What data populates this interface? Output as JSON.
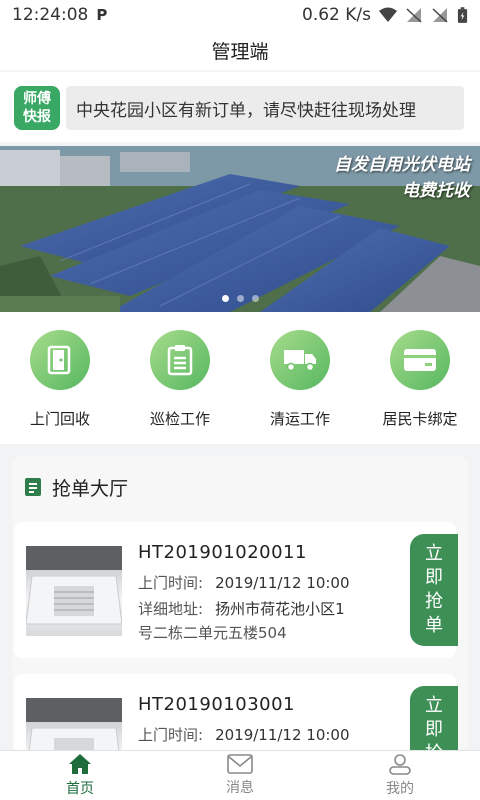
{
  "status": {
    "time": "12:24:08",
    "notification_app": "P",
    "speed": "0.62 K/s"
  },
  "header": {
    "title": "管理端"
  },
  "notice": {
    "badge_line1": "师傅",
    "badge_line2": "快报",
    "text": "中央花园小区有新订单，请尽快赶往现场处理"
  },
  "banner": {
    "caption_line1": "自发自用光伏电站",
    "caption_line2": "电费托收",
    "slides": 3,
    "active_slide": 0
  },
  "menu": [
    {
      "label": "上门回收",
      "icon": "door-icon"
    },
    {
      "label": "巡检工作",
      "icon": "clipboard-icon"
    },
    {
      "label": "清运工作",
      "icon": "truck-icon"
    },
    {
      "label": "居民卡绑定",
      "icon": "card-icon"
    }
  ],
  "hall": {
    "title": "抢单大厅",
    "orders": [
      {
        "id": "HT201901020011",
        "time_label": "上门时间:",
        "time": "2019/11/12 10:00",
        "addr_label": "详细地址:",
        "addr_line1": "扬州市荷花池小区1",
        "addr_line2": "号二栋二单元五楼504",
        "button_label": "立即抢单"
      },
      {
        "id": "HT20190103001",
        "time_label": "上门时间:",
        "time": "2019/11/12 10:00",
        "button_label": "立即抢单"
      }
    ]
  },
  "tabs": [
    {
      "label": "首页",
      "icon": "home-icon",
      "active": true
    },
    {
      "label": "消息",
      "icon": "mail-icon",
      "active": false
    },
    {
      "label": "我的",
      "icon": "user-icon",
      "active": false
    }
  ],
  "colors": {
    "accent": "#3d8f55",
    "tab_active": "#1e6b3c",
    "badge": "#3aa865"
  }
}
